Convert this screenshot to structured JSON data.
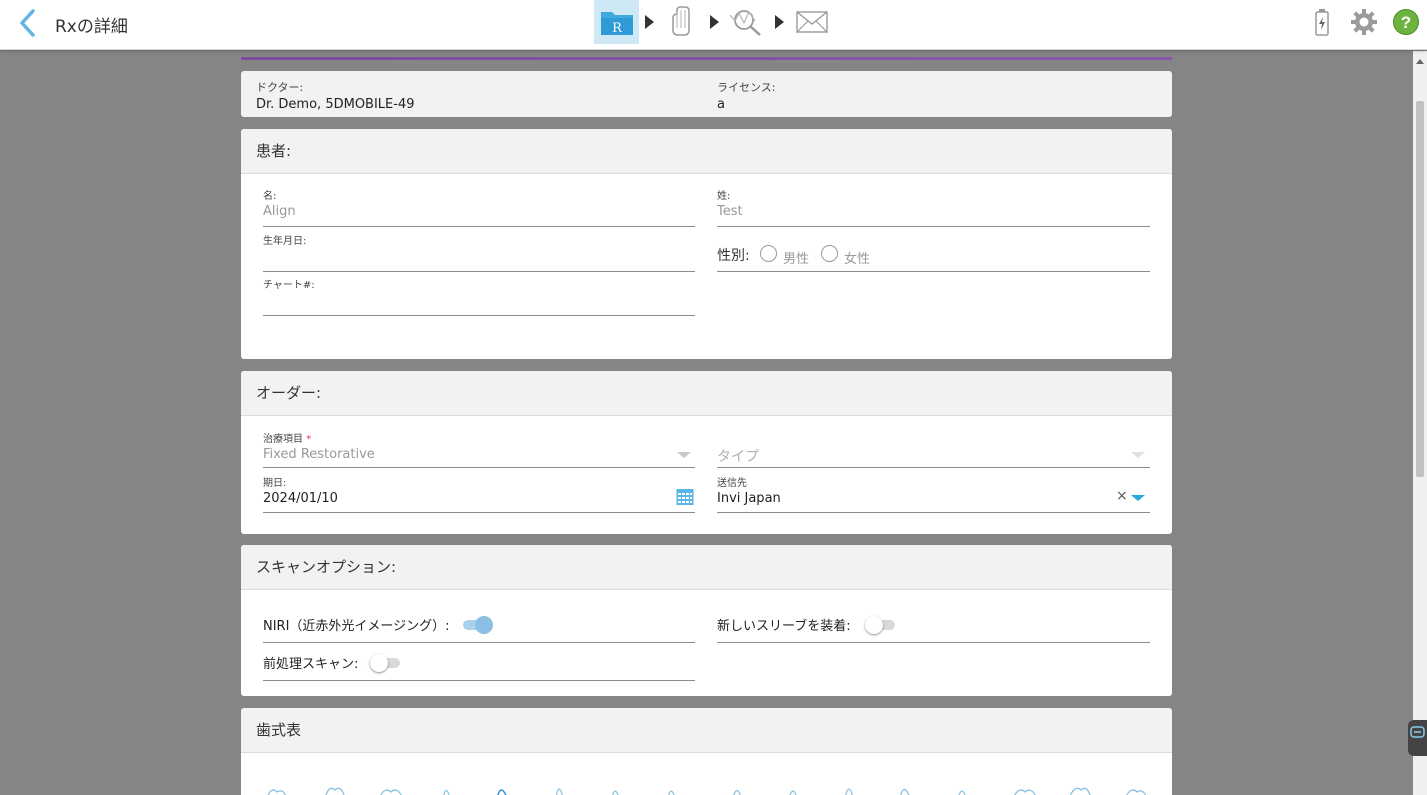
{
  "header": {
    "title": "Rxの詳細",
    "steps": [
      "rx-step",
      "scan-step",
      "review-step",
      "send-step"
    ],
    "right_icons": [
      "battery-icon",
      "settings-gear-icon",
      "help-icon"
    ]
  },
  "doctor": {
    "doctor_label": "ドクター:",
    "doctor_value": "Dr. Demo, 5DMOBILE-49",
    "license_label": "ライセンス:",
    "license_value": "a"
  },
  "patient": {
    "header": "患者:",
    "first_name_label": "名:",
    "first_name_value": "Align",
    "last_name_label": "姓:",
    "last_name_value": "Test",
    "dob_label": "生年月日:",
    "dob_value": "",
    "gender_label": "性別:",
    "male_label": "男性",
    "female_label": "女性",
    "chart_label": "チャート#:",
    "chart_value": ""
  },
  "order": {
    "header": "オーダー:",
    "treatment_label": "治療項目",
    "required_mark": "*",
    "treatment_value": "Fixed Restorative",
    "type_placeholder": "タイプ",
    "due_label": "期日:",
    "due_value": "2024/01/10",
    "ship_label": "送信先",
    "ship_value": "Invi Japan",
    "clear_symbol": "×"
  },
  "scan_options": {
    "header": "スキャンオプション:",
    "niri_label": "NIRI（近赤外光イメージング）:",
    "niri_on": true,
    "sleeve_label": "新しいスリーブを装着:",
    "sleeve_on": false,
    "preprocess_label": "前処理スキャン:",
    "preprocess_on": false
  },
  "tooth_chart": {
    "header": "歯式表"
  },
  "colors": {
    "accent": "#29a8e0",
    "purple": "#7b4d9b",
    "background": "#858587",
    "help_green": "#6cb33f"
  }
}
